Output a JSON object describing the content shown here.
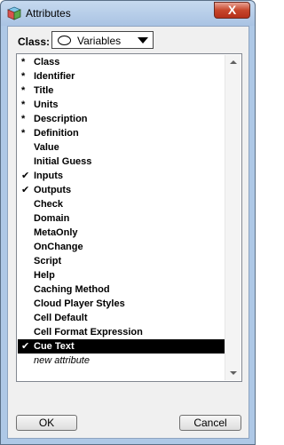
{
  "window": {
    "title": "Attributes",
    "close_symbol": "X"
  },
  "class_selector": {
    "label": "Class:",
    "value": "Variables"
  },
  "attributes": [
    {
      "marker": "*",
      "label": "Class",
      "selected": false
    },
    {
      "marker": "*",
      "label": "Identifier",
      "selected": false
    },
    {
      "marker": "*",
      "label": "Title",
      "selected": false
    },
    {
      "marker": "*",
      "label": "Units",
      "selected": false
    },
    {
      "marker": "*",
      "label": "Description",
      "selected": false
    },
    {
      "marker": "*",
      "label": "Definition",
      "selected": false
    },
    {
      "marker": "",
      "label": "Value",
      "selected": false
    },
    {
      "marker": "",
      "label": "Initial Guess",
      "selected": false
    },
    {
      "marker": "✔",
      "label": "Inputs",
      "selected": false
    },
    {
      "marker": "✔",
      "label": "Outputs",
      "selected": false
    },
    {
      "marker": "",
      "label": "Check",
      "selected": false
    },
    {
      "marker": "",
      "label": "Domain",
      "selected": false
    },
    {
      "marker": "",
      "label": "MetaOnly",
      "selected": false
    },
    {
      "marker": "",
      "label": "OnChange",
      "selected": false
    },
    {
      "marker": "",
      "label": "Script",
      "selected": false
    },
    {
      "marker": "",
      "label": "Help",
      "selected": false
    },
    {
      "marker": "",
      "label": "Caching Method",
      "selected": false
    },
    {
      "marker": "",
      "label": "Cloud Player Styles",
      "selected": false
    },
    {
      "marker": "",
      "label": "Cell Default",
      "selected": false
    },
    {
      "marker": "",
      "label": "Cell Format Expression",
      "selected": false
    },
    {
      "marker": "✔",
      "label": "Cue Text",
      "selected": true
    }
  ],
  "new_attribute_label": "new attribute",
  "buttons": {
    "ok": "OK",
    "cancel": "Cancel"
  }
}
